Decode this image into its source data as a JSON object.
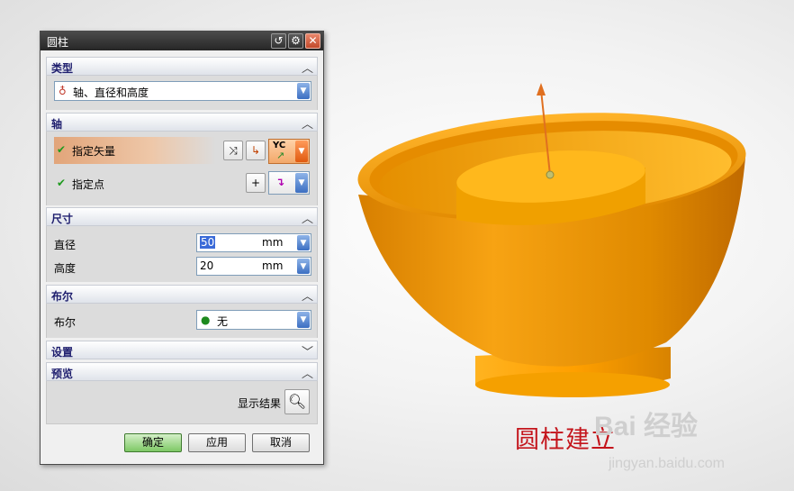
{
  "dialog": {
    "title": "圆柱",
    "type_section": {
      "label": "类型",
      "selected": "轴、直径和高度"
    },
    "axis_section": {
      "label": "轴",
      "specify_vector": "指定矢量",
      "specify_point": "指定点",
      "vector_button": "YC"
    },
    "dimensions_section": {
      "label": "尺寸",
      "diameter_label": "直径",
      "diameter_value": "50",
      "diameter_unit": "mm",
      "height_label": "高度",
      "height_value": "20",
      "height_unit": "mm"
    },
    "boolean_section": {
      "label": "布尔",
      "row_label": "布尔",
      "selected": "无"
    },
    "settings_section": {
      "label": "设置"
    },
    "preview_section": {
      "label": "预览",
      "show_result": "显示结果"
    },
    "buttons": {
      "ok": "确定",
      "apply": "应用",
      "cancel": "取消"
    }
  },
  "caption": "圆柱建立",
  "watermark": {
    "brand": "Bai 经验",
    "url": "jingyan.baidu.com"
  },
  "colors": {
    "model_orange": "#f0a000",
    "caption_red": "#c4151c",
    "title_bar": "#333333"
  }
}
